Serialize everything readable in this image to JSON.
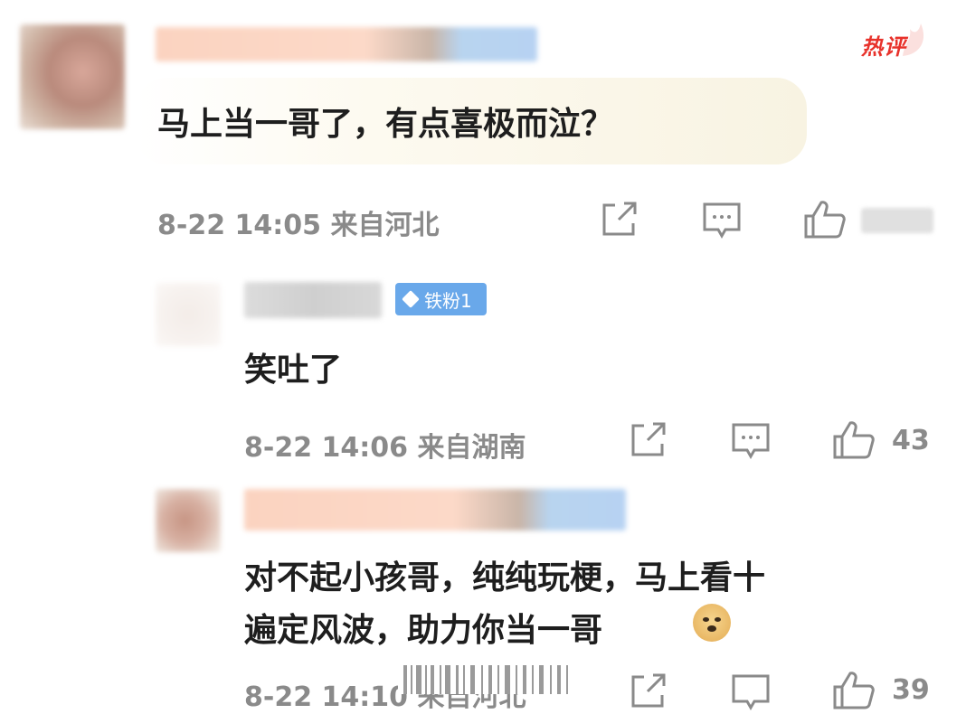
{
  "main_comment": {
    "text": "马上当一哥了，有点喜极而泣？",
    "hot_badge": "热评",
    "time": "8-22 14:05",
    "location": "来自河北",
    "icons": [
      "share-icon",
      "comment-icon",
      "like-icon"
    ]
  },
  "replies": [
    {
      "fan_badge": "铁粉1",
      "text": "笑吐了",
      "time": "8-22 14:06",
      "location": "来自湖南",
      "likes": "43"
    },
    {
      "text_line1": "对不起小孩哥，纯纯玩梗，马上看十",
      "text_line2": "遍定风波，助力你当一哥",
      "time": "8-22 14:10",
      "location": "来自河北",
      "likes": "39"
    }
  ],
  "colors": {
    "hot_red": "#e8322b",
    "meta_gray": "#8a8a8a",
    "fan_badge_blue": "#69a8ea"
  }
}
